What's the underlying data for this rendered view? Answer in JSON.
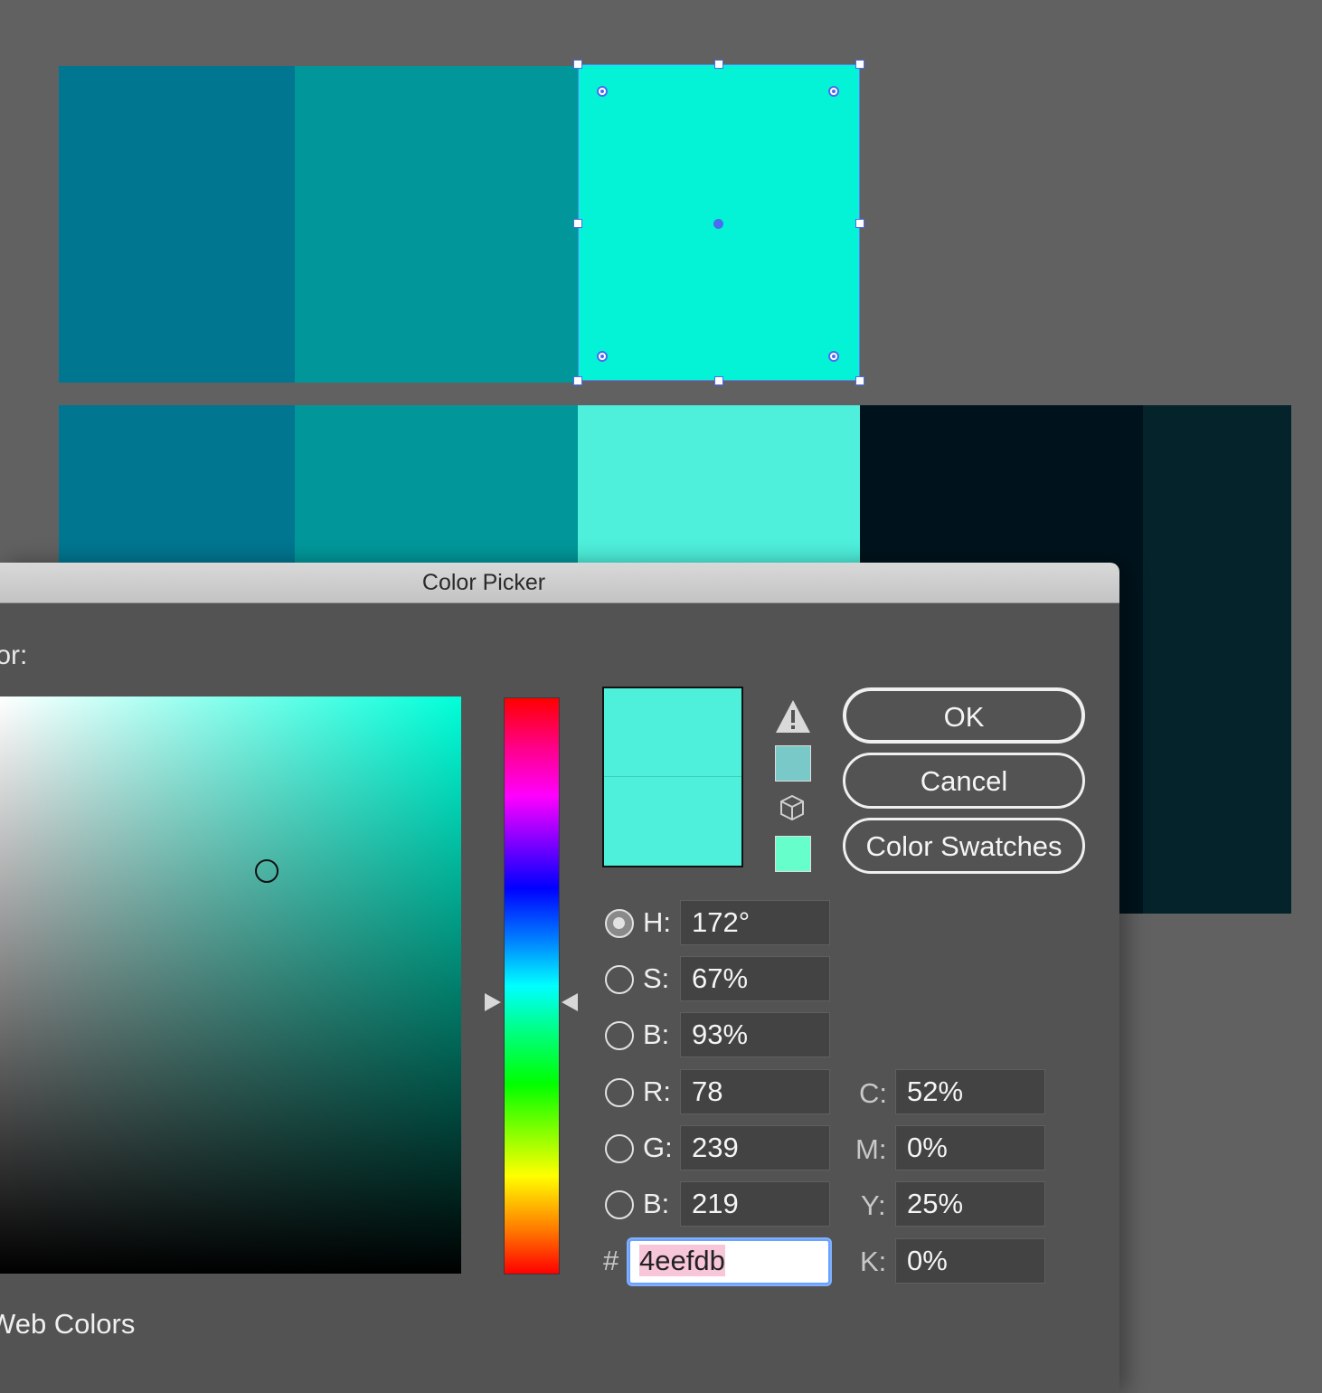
{
  "colors": {
    "background": "#616161",
    "swatch_dark_teal": "#007690",
    "swatch_teal": "#01979a",
    "swatch_selected": "#04f3d6",
    "swatch_light": "#4eefdb",
    "swatch_navy": "#00131c",
    "swatch_deep": "#04232a",
    "selection_blue": "#4a6cf0",
    "current_color": "#4eefdb",
    "out_of_gamut_swatch": "#79c9c8",
    "web_safe_swatch": "#66ffcc"
  },
  "dialog": {
    "title": "Color Picker",
    "select_label": "olor:",
    "buttons": {
      "ok": "OK",
      "cancel": "Cancel",
      "swatches": "Color Swatches"
    },
    "fields": {
      "h_label": "H:",
      "h_value": "172°",
      "s_label": "S:",
      "s_value": "67%",
      "b_label": "B:",
      "b_value": "93%",
      "r_label": "R:",
      "r_value": "78",
      "g_label": "G:",
      "g_value": "239",
      "bl_label": "B:",
      "bl_value": "219",
      "c_label": "C:",
      "c_value": "52%",
      "m_label": "M:",
      "m_value": "0%",
      "y_label": "Y:",
      "y_value": "25%",
      "k_label": "K:",
      "k_value": "0%",
      "hex_symbol": "#",
      "hex_value": "4eefdb"
    },
    "selected_mode": "H",
    "web_colors_label": "Web Colors",
    "icons": {
      "gamut_warning": "warning-triangle-icon",
      "web_safe": "cube-icon"
    }
  }
}
